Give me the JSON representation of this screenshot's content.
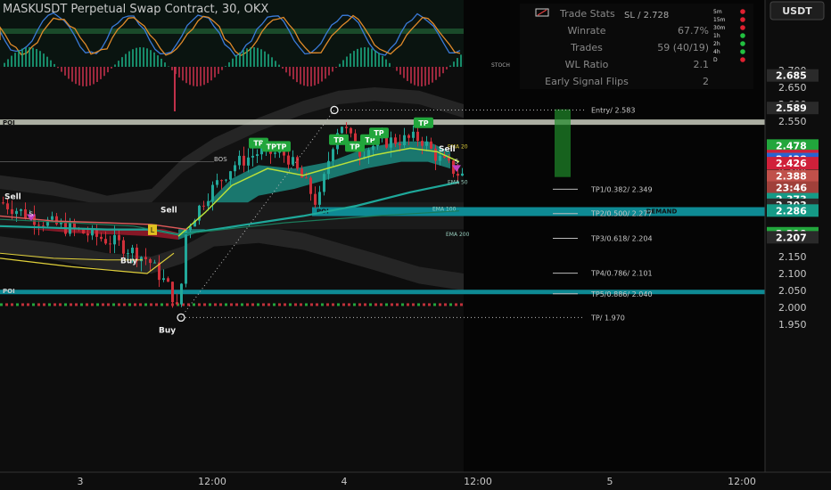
{
  "header": {
    "title": "MASKUSDT Perpetual Swap Contract, 30, OKX",
    "currency_button": "USDT"
  },
  "stats_panel": {
    "title": "Trade Stats",
    "rows": [
      {
        "label": "Winrate",
        "value": "67.7%"
      },
      {
        "label": "Trades",
        "value": "59 (40/19)"
      },
      {
        "label": "WL Ratio",
        "value": "2.1"
      },
      {
        "label": "Early Signal Flips",
        "value": "2"
      }
    ],
    "sl_label": "SL / 2.728"
  },
  "mtf_panel": {
    "items": [
      {
        "label": "5m",
        "status": "red"
      },
      {
        "label": "15m",
        "status": "red"
      },
      {
        "label": "30m",
        "status": "red"
      },
      {
        "label": "1h",
        "status": "green"
      },
      {
        "label": "2h",
        "status": "green"
      },
      {
        "label": "4h",
        "status": "green"
      },
      {
        "label": "D",
        "status": "red"
      }
    ]
  },
  "oscillator_label": "STOCH",
  "axis": {
    "y_ticks": [
      "2.700",
      "2.650",
      "2.600",
      "2.550",
      "2.400",
      "2.350",
      "2.150",
      "2.100",
      "2.050",
      "2.000",
      "1.950"
    ],
    "x_ticks": [
      {
        "label": "3",
        "at": "2024-01-03 00:00"
      },
      {
        "label": "12:00",
        "at": "2024-01-03 12:00"
      },
      {
        "label": "4",
        "at": "2024-01-04 00:00"
      },
      {
        "label": "12:00",
        "at": "2024-01-04 12:00"
      },
      {
        "label": "5",
        "at": "2024-01-05 00:00"
      },
      {
        "label": "12:00",
        "at": "2024-01-05 12:00"
      }
    ]
  },
  "price_badges": [
    {
      "value": "2.685",
      "color": "#2a2a2a"
    },
    {
      "value": "2.589",
      "color": "#2a2a2a"
    },
    {
      "value": "2.478",
      "color": "#22a63c"
    },
    {
      "value": "2.447",
      "color": "#d0203a"
    },
    {
      "value": "2.446",
      "color": "#d0203a"
    },
    {
      "value": "2.4389",
      "color": "#d0402a"
    },
    {
      "value": "2.438",
      "color": "#2a62d0"
    },
    {
      "value": "2.426",
      "color": "#d0203a"
    },
    {
      "value": "2.388",
      "color": "#c0504a"
    },
    {
      "value": "23:46",
      "color": "#a0403a"
    },
    {
      "value": "2.373",
      "color": "#159a86"
    },
    {
      "value": "2.303",
      "color": "#2a2a2a"
    },
    {
      "value": "2.286",
      "color": "#159a86"
    },
    {
      "value": "2.219",
      "color": "#22a63c"
    },
    {
      "value": "2.207",
      "color": "#2a2a2a"
    }
  ],
  "trade_levels": [
    {
      "label": "Entry/ 2.583",
      "price": 2.583
    },
    {
      "label": "TP1/0.382/ 2.349",
      "price": 2.349
    },
    {
      "label": "TP2/0.500/ 2.277",
      "price": 2.277
    },
    {
      "label": "TP3/0.618/ 2.204",
      "price": 2.204
    },
    {
      "label": "TP4/0.786/ 2.101",
      "price": 2.101
    },
    {
      "label": "TP5/0.886/ 2.040",
      "price": 2.04
    },
    {
      "label": "TP/ 1.970",
      "price": 1.97
    }
  ],
  "zones": {
    "poi": "POI",
    "demand": "DEMAND"
  },
  "ema_labels": [
    "EMA 20",
    "EMA 50",
    "EMA 100",
    "EMA 200"
  ],
  "signals": {
    "tp": "TP",
    "tptp": "TPTP",
    "sell": "Sell",
    "buy": "Buy",
    "s": "S",
    "l": "L",
    "bos": "BOS"
  },
  "colors": {
    "background": "#0d0d0d",
    "bull": "#22a89a",
    "bear": "#d0303a",
    "poi": "#c9ccbe",
    "teal_zone": "#0e8a94",
    "entry_box": "#1f8a2a"
  },
  "chart_data": {
    "type": "candlestick",
    "title": "MASKUSDT Perpetual Swap Contract, 30, OKX",
    "y_range": [
      1.93,
      2.73
    ],
    "price_series": [
      {
        "t": "3 00:00",
        "price": 2.31
      },
      {
        "t": "3 06:00",
        "price": 2.23
      },
      {
        "t": "3 10:30",
        "price": 2.13
      },
      {
        "t": "3 11:30",
        "price": 1.97
      },
      {
        "t": "3 13:00",
        "price": 2.27
      },
      {
        "t": "3 18:00",
        "price": 2.47
      },
      {
        "t": "3 23:00",
        "price": 2.58
      },
      {
        "t": "4 03:00",
        "price": 2.32
      },
      {
        "t": "4 07:00",
        "price": 2.5
      },
      {
        "t": "4 10:00",
        "price": 2.47
      },
      {
        "t": "4 11:00",
        "price": 2.39
      }
    ]
  }
}
